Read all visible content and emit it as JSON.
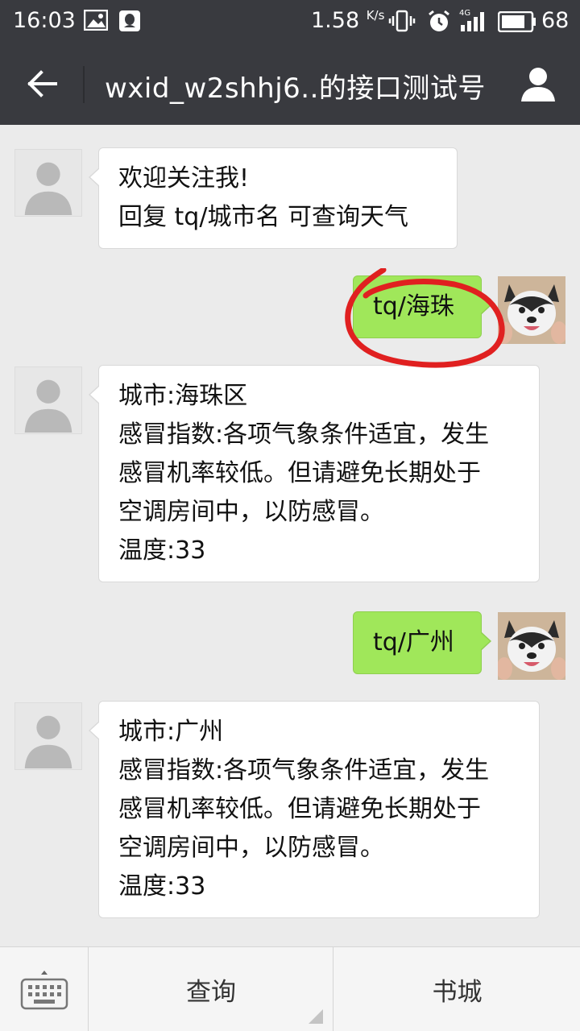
{
  "status_bar": {
    "time": "16:03",
    "network_speed": "1.58",
    "network_speed_unit": "K/s",
    "signal_type": "4G",
    "battery_level": "68"
  },
  "title_bar": {
    "title": "wxid_w2shhj6..的接口测试号"
  },
  "messages": [
    {
      "side": "left",
      "lines": [
        "欢迎关注我!",
        "回复 tq/城市名 可查询天气"
      ]
    },
    {
      "side": "right",
      "lines": [
        "tq/海珠"
      ]
    },
    {
      "side": "left",
      "lines": [
        "城市:海珠区",
        "感冒指数:各项气象条件适宜，发生",
        "感冒机率较低。但请避免长期处于",
        "空调房间中，以防感冒。",
        "温度:33"
      ]
    },
    {
      "side": "right",
      "lines": [
        "tq/广州"
      ]
    },
    {
      "side": "left",
      "lines": [
        "城市:广州",
        "感冒指数:各项气象条件适宜，发生",
        "感冒机率较低。但请避免长期处于",
        "空调房间中，以防感冒。",
        "温度:33"
      ]
    }
  ],
  "bottom_menu": {
    "items": [
      "查询",
      "书城"
    ]
  },
  "colors": {
    "header_bg": "#393a3f",
    "chat_bg": "#ebebeb",
    "sent_bubble": "#a0e75a",
    "received_bubble": "#ffffff",
    "annotation_circle": "#e02020"
  }
}
